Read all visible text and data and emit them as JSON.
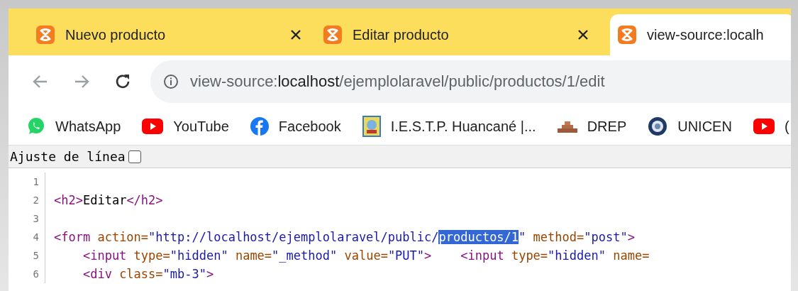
{
  "tabs": [
    {
      "title": "Nuevo producto",
      "selected": false,
      "closable": true
    },
    {
      "title": "Editar producto",
      "selected": false,
      "closable": true
    },
    {
      "title": "view-source:localh",
      "selected": true,
      "closable": false
    }
  ],
  "address": {
    "parts": [
      {
        "kind": "scheme",
        "text": "view-source:"
      },
      {
        "kind": "host",
        "text": "localhost"
      },
      {
        "kind": "path",
        "text": "/ejemplolaravel/public/productos/1/edit"
      }
    ]
  },
  "bookmarks": [
    {
      "kind": "whatsapp",
      "label": "WhatsApp"
    },
    {
      "kind": "youtube",
      "label": "YouTube"
    },
    {
      "kind": "facebook",
      "label": "Facebook"
    },
    {
      "kind": "crest",
      "label": "I.E.S.T.P. Huancané |..."
    },
    {
      "kind": "bars",
      "label": "DREP"
    },
    {
      "kind": "seal",
      "label": "UNICEN"
    },
    {
      "kind": "youtube",
      "label": "("
    }
  ],
  "line_wrap": {
    "label": "Ajuste de línea",
    "checked": false
  },
  "source_lines": [
    {
      "number": "1"
    },
    {
      "number": "2",
      "tokens": [
        {
          "kind": "tag",
          "text": "<h2>"
        },
        {
          "kind": "text",
          "text": "Editar"
        },
        {
          "kind": "tag",
          "text": "</h2>"
        }
      ]
    },
    {
      "number": "3"
    },
    {
      "number": "4",
      "tokens": [
        {
          "kind": "tag",
          "text": "<form"
        },
        {
          "kind": "attr",
          "text": " action="
        },
        {
          "kind": "value",
          "text": "\"http://localhost/ejemplolaravel/public/"
        },
        {
          "kind": "selected",
          "text": "productos/1"
        },
        {
          "kind": "value",
          "text": "\""
        },
        {
          "kind": "attr",
          "text": " method="
        },
        {
          "kind": "value",
          "text": "\"post\""
        },
        {
          "kind": "tag",
          "text": ">"
        }
      ]
    },
    {
      "number": "5",
      "tokens": [
        {
          "kind": "tag",
          "text": "    <input"
        },
        {
          "kind": "attr",
          "text": " type="
        },
        {
          "kind": "value",
          "text": "\"hidden\""
        },
        {
          "kind": "attr",
          "text": " name="
        },
        {
          "kind": "value",
          "text": "\"_method\""
        },
        {
          "kind": "attr",
          "text": " value="
        },
        {
          "kind": "value",
          "text": "\"PUT\""
        },
        {
          "kind": "tag",
          "text": ">"
        },
        {
          "kind": "tag",
          "text": "    <input"
        },
        {
          "kind": "attr",
          "text": " type="
        },
        {
          "kind": "value",
          "text": "\"hidden\""
        },
        {
          "kind": "attr",
          "text": " name="
        }
      ]
    },
    {
      "number": "6",
      "tokens": [
        {
          "kind": "tag",
          "text": "    <div"
        },
        {
          "kind": "attr",
          "text": " class="
        },
        {
          "kind": "value",
          "text": "\"mb-3\""
        },
        {
          "kind": "tag",
          "text": ">"
        }
      ]
    }
  ]
}
